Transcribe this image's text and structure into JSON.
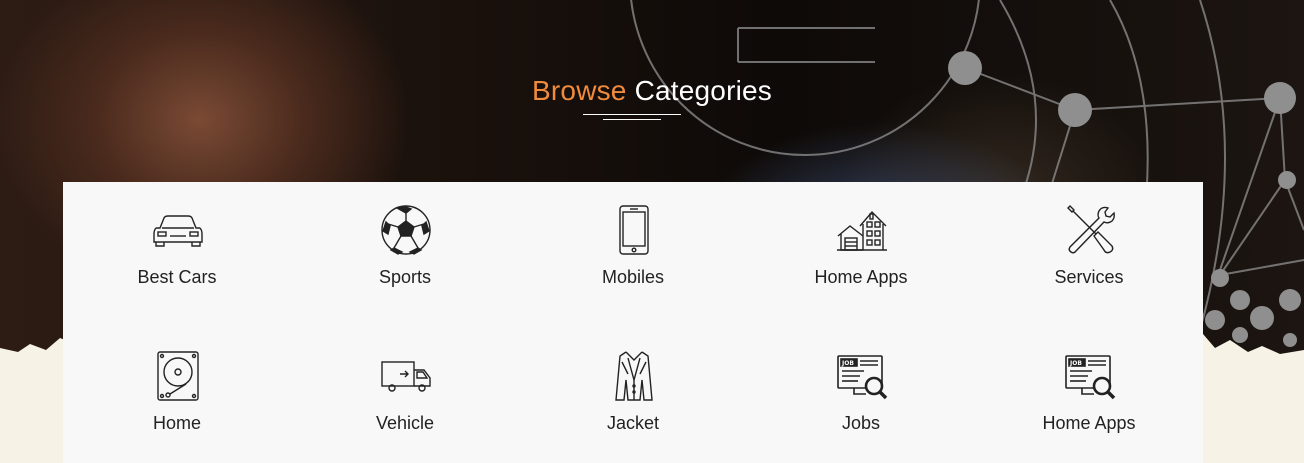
{
  "heading": {
    "accent": "Browse",
    "main": "Categories"
  },
  "colors": {
    "accent": "#f08a3c",
    "panel": "#f8f8f8",
    "text": "#222222"
  },
  "categories": [
    {
      "label": "Best Cars",
      "icon": "car-icon"
    },
    {
      "label": "Sports",
      "icon": "soccer-ball-icon"
    },
    {
      "label": "Mobiles",
      "icon": "mobile-phone-icon"
    },
    {
      "label": "Home Apps",
      "icon": "houses-icon"
    },
    {
      "label": "Services",
      "icon": "tools-icon"
    },
    {
      "label": "Home",
      "icon": "hard-drive-icon"
    },
    {
      "label": "Vehicle",
      "icon": "truck-icon"
    },
    {
      "label": "Jacket",
      "icon": "jacket-icon"
    },
    {
      "label": "Jobs",
      "icon": "job-search-icon"
    },
    {
      "label": "Home Apps",
      "icon": "job-search-icon"
    }
  ]
}
